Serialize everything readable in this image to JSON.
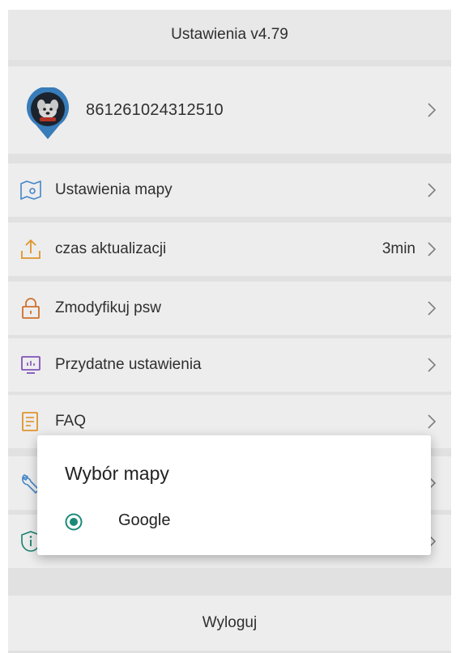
{
  "header": {
    "title": "Ustawienia v4.79"
  },
  "profile": {
    "device_id": "861261024312510",
    "avatar_icon": "dog-pin-avatar-icon"
  },
  "menu": {
    "items": [
      {
        "label": "Ustawienia mapy",
        "icon": "map-icon",
        "value": ""
      },
      {
        "label": "czas aktualizacji",
        "icon": "upload-icon",
        "value": "3min"
      },
      {
        "label": "Zmodyfikuj psw",
        "icon": "lock-icon",
        "value": ""
      },
      {
        "label": "Przydatne ustawienia",
        "icon": "monitor-icon",
        "value": ""
      },
      {
        "label": "FAQ",
        "icon": "document-icon",
        "value": ""
      }
    ]
  },
  "logout": {
    "label": "Wyloguj"
  },
  "dialog": {
    "title": "Wybór mapy",
    "options": [
      {
        "label": "Google",
        "selected": true
      }
    ]
  },
  "colors": {
    "accent": "#1a8a78",
    "icon_blue": "#4a90d9",
    "icon_orange": "#f0a030",
    "icon_purple": "#8a5bc9",
    "icon_orange_dark": "#e07a30"
  }
}
